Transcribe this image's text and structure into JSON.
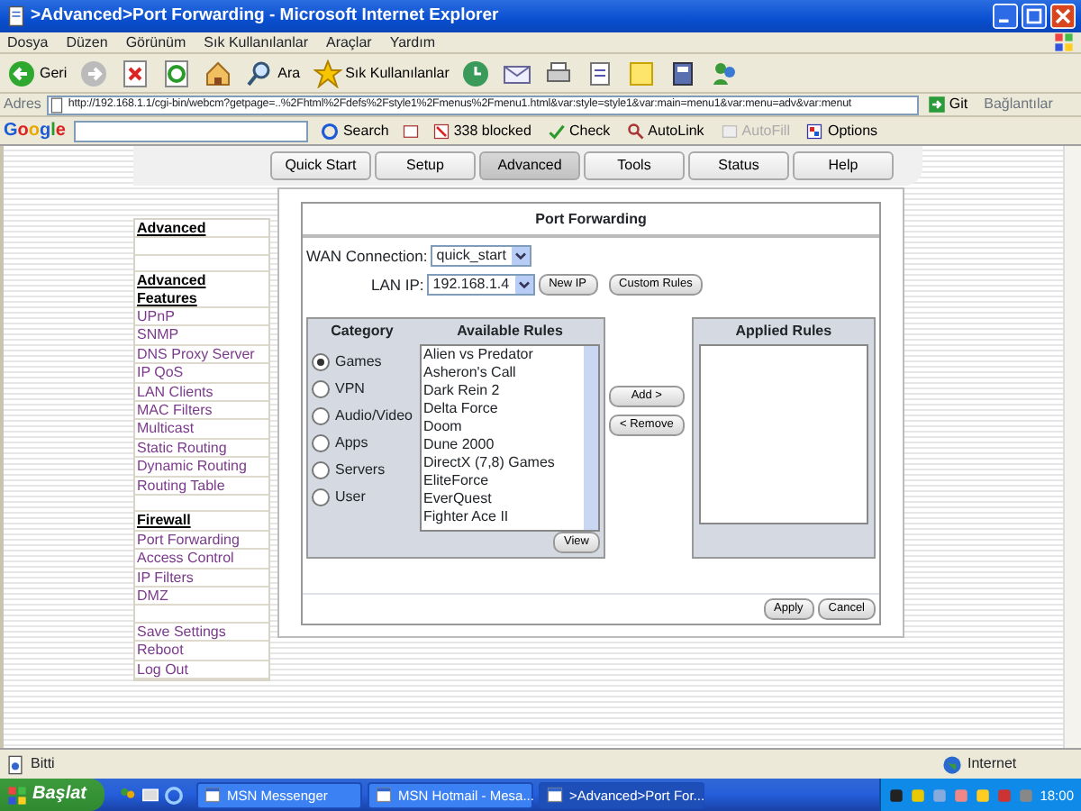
{
  "window": {
    "title": ">Advanced>Port Forwarding - Microsoft Internet Explorer"
  },
  "menu_bar": [
    "Dosya",
    "Düzen",
    "Görünüm",
    "Sık Kullanılanlar",
    "Araçlar",
    "Yardım"
  ],
  "toolbar": [
    {
      "kind": "back",
      "label": "Geri"
    },
    {
      "kind": "forward"
    },
    {
      "kind": "stop"
    },
    {
      "kind": "refresh"
    },
    {
      "kind": "home"
    },
    {
      "kind": "search",
      "label": "Ara"
    },
    {
      "kind": "favorites",
      "label": "Sık Kullanılanlar"
    },
    {
      "kind": "history"
    },
    {
      "kind": "mail"
    },
    {
      "kind": "print"
    },
    {
      "kind": "edit"
    },
    {
      "kind": "notes"
    },
    {
      "kind": "research"
    },
    {
      "kind": "messenger"
    }
  ],
  "address_bar": {
    "label": "Adres",
    "value": "http://192.168.1.1/cgi-bin/webcm?getpage=..%2Fhtml%2Fdefs%2Fstyle1%2Fmenus%2Fmenu1.html&var:style=style1&var:main=menu1&var:menu=adv&var:menut",
    "go": "Git",
    "links": "Bağlantılar"
  },
  "google_bar": {
    "logo": "Google",
    "search": "Search",
    "blocked": "338 blocked",
    "check": "Check",
    "autolink": "AutoLink",
    "autofill": {
      "label": "AutoFill",
      "disabled": true
    },
    "options": "Options"
  },
  "page": {
    "tabs": [
      {
        "label": "Quick Start",
        "selected": false
      },
      {
        "label": "Setup",
        "selected": false
      },
      {
        "label": "Advanced",
        "selected": true
      },
      {
        "label": "Tools",
        "selected": false
      },
      {
        "label": "Status",
        "selected": false
      },
      {
        "label": "Help",
        "selected": false
      }
    ],
    "sidebar": [
      {
        "heading": "Advanced"
      },
      {
        "heading": "Advanced Features",
        "items": [
          "UPnP",
          "SNMP",
          "DNS Proxy Server",
          "IP QoS",
          "LAN Clients",
          "MAC Filters",
          "Multicast",
          "Static Routing",
          "Dynamic Routing",
          "Routing Table"
        ]
      },
      {
        "heading": "Firewall",
        "items": [
          "Port Forwarding",
          "Access Control",
          "IP Filters",
          "DMZ"
        ]
      },
      {
        "items": [
          "Save Settings",
          "Reboot",
          "Log Out"
        ]
      }
    ],
    "panel": {
      "title": "Port Forwarding",
      "wan_connection": {
        "label": "WAN Connection:",
        "value": "quick_start"
      },
      "lan_ip": {
        "label": "LAN IP:",
        "value": "192.168.1.4"
      },
      "new_ip": "New IP",
      "custom_rules": "Custom Rules",
      "category": {
        "header": "Category",
        "options": [
          {
            "label": "Games",
            "selected": true
          },
          {
            "label": "VPN",
            "selected": false
          },
          {
            "label": "Audio/Video",
            "selected": false
          },
          {
            "label": "Apps",
            "selected": false
          },
          {
            "label": "Servers",
            "selected": false
          },
          {
            "label": "User",
            "selected": false
          }
        ]
      },
      "available_rules": {
        "header": "Available Rules",
        "items": [
          "Alien vs Predator",
          "Asheron's Call",
          "Dark Rein 2",
          "Delta Force",
          "Doom",
          "Dune 2000",
          "DirectX (7,8) Games",
          "EliteForce",
          "EverQuest",
          "Fighter Ace II"
        ]
      },
      "view": "View",
      "add": "Add >",
      "remove": "< Remove",
      "applied_rules": {
        "header": "Applied Rules"
      },
      "apply": "Apply",
      "cancel": "Cancel"
    }
  },
  "status_bar": {
    "text": "Bitti",
    "zone": "Internet"
  },
  "taskbar": {
    "start": "Başlat",
    "tasks": [
      {
        "label": "MSN Messenger",
        "selected": false
      },
      {
        "label": "MSN Hotmail - Mesa...",
        "selected": false
      },
      {
        "label": ">Advanced>Port For...",
        "selected": true
      }
    ],
    "clock": "18:00"
  }
}
